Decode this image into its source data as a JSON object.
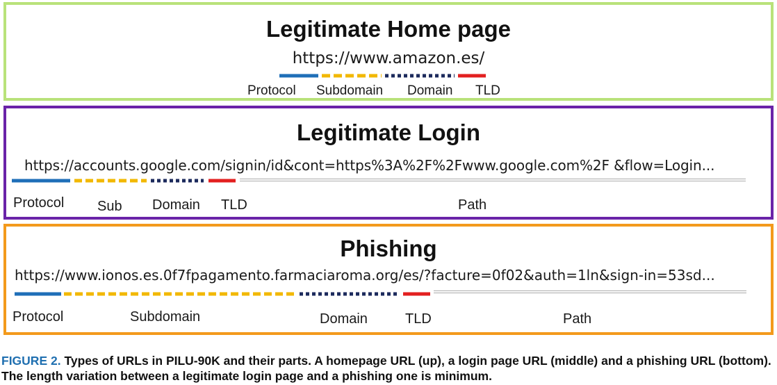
{
  "colors": {
    "panel1_border": "#b9e27a",
    "panel2_border": "#6a23a8",
    "panel3_border": "#f39a1c",
    "protocol": "#1f6fb8",
    "subdomain": "#f2b800",
    "domain": "#1c2a5c",
    "tld": "#e32020",
    "path": "#aaaaaa",
    "caption_label": "#1f6fb0"
  },
  "panel1": {
    "title": "Legitimate Home page",
    "url": "https://www.amazon.es/",
    "labels": {
      "protocol": "Protocol",
      "subdomain": "Subdomain",
      "domain": "Domain",
      "tld": "TLD"
    }
  },
  "panel2": {
    "title": "Legitimate Login",
    "url": "https://accounts.google.com/signin/id&cont=https%3A%2F%2Fwww.google.com%2F &flow=Login...",
    "labels": {
      "protocol": "Protocol",
      "subdomain": "Sub",
      "domain": "Domain",
      "tld": "TLD",
      "path": "Path"
    }
  },
  "panel3": {
    "title": "Phishing",
    "url": "https://www.ionos.es.0f7fpagamento.farmaciaroma.org/es/?facture=0f02&auth=1ln&sign-in=53sd...",
    "labels": {
      "protocol": "Protocol",
      "subdomain": "Subdomain",
      "domain": "Domain",
      "tld": "TLD",
      "path": "Path"
    }
  },
  "caption": {
    "label": "FIGURE 2.",
    "text": "Types of URLs in PILU-90K and their parts. A homepage URL (up), a login page URL (middle) and a phishing URL (bottom). The length variation between a legitimate login page and a phishing one is minimum."
  }
}
